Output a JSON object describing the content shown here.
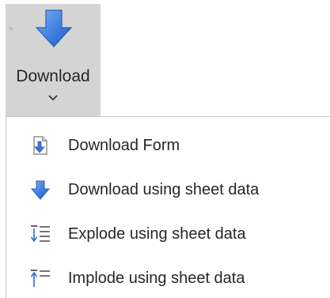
{
  "ribbon": {
    "download_label": "Download",
    "icon": "download-arrow-icon",
    "chevron_icon": "chevron-down-icon",
    "accent_color": "#3b74d6",
    "pressed_background": "#d4d4d4"
  },
  "menu": {
    "items": [
      {
        "label": "Download Form",
        "icon": "download-form-icon"
      },
      {
        "label": "Download using sheet data",
        "icon": "download-arrow-icon"
      },
      {
        "label": "Explode using sheet data",
        "icon": "explode-list-icon"
      },
      {
        "label": "Implode using sheet data",
        "icon": "implode-list-icon"
      }
    ]
  }
}
